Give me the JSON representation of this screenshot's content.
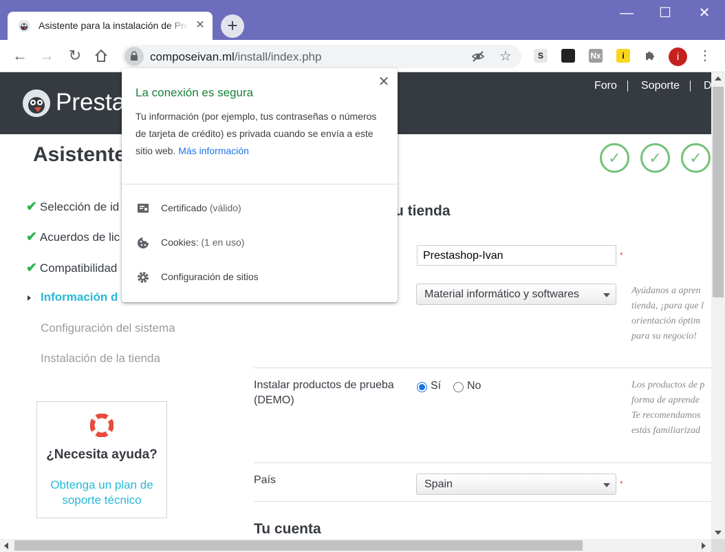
{
  "browser": {
    "tab_title": "Asistente para la instalación de PrestaShop",
    "tab_close": "✕",
    "new_tab": "+",
    "window_controls": {
      "minimize": "—",
      "maximize": "☐",
      "close": "✕"
    },
    "url_host": "composeivan.ml",
    "url_path": "/install/index.php",
    "extensions": [
      {
        "name": "S",
        "bg": "#e8e8e8",
        "color": "#222"
      },
      {
        "name": "",
        "bg": "#222",
        "color": "#fff"
      },
      {
        "name": "Nx",
        "bg": "#9e9e9e",
        "color": "#fff"
      },
      {
        "name": "i",
        "bg": "#f9d71c",
        "color": "#000"
      }
    ],
    "avatar_letter": "i"
  },
  "header": {
    "brand": "Presta",
    "nav": [
      "Foro",
      "Soporte",
      "D"
    ]
  },
  "wizard": {
    "title": "Asistente",
    "steps": [
      {
        "label": "Selección de id",
        "state": "done"
      },
      {
        "label": "Acuerdos de lic",
        "state": "done"
      },
      {
        "label": "Compatibilidad",
        "state": "done"
      },
      {
        "label": "Información d",
        "state": "active"
      },
      {
        "label": "Configuración del sistema",
        "state": "pending"
      },
      {
        "label": "Instalación de la tienda",
        "state": "pending"
      }
    ],
    "check_mark": "✓"
  },
  "help": {
    "title": "¿Necesita ayuda?",
    "link": "Obtenga un plan de soporte técnico"
  },
  "form": {
    "section_heading_fragment": "u tienda",
    "shop_name": "Prestashop-Ivan",
    "activity": "Material informático y softwares",
    "activity_hint": [
      "Ayúdanos a apren",
      "tienda, ¡para que l",
      "orientación óptim",
      "para su negocio!"
    ],
    "demo_label": "Instalar productos de prueba (DEMO)",
    "demo_yes": "Sí",
    "demo_no": "No",
    "demo_selected": "Sí",
    "demo_hint": [
      "Los productos de p",
      "forma de aprende",
      "Te recomendamos",
      "estás familiarizad"
    ],
    "country_label": "País",
    "country": "Spain",
    "required_mark": "*",
    "account_heading": "Tu cuenta"
  },
  "popup": {
    "title": "La conexión es segura",
    "close": "✕",
    "description": "Tu información (por ejemplo, tus contraseñas o números de tarjeta de crédito) es privada cuando se envía a este sitio web.",
    "more_info": "Más información",
    "rows": [
      {
        "label": "Certificado",
        "sub": "(válido)",
        "icon": "certificate-icon"
      },
      {
        "label": "Cookies:",
        "sub": "(1 en uso)",
        "icon": "cookie-icon"
      },
      {
        "label": "Configuración de sitios",
        "sub": "",
        "icon": "settings-icon"
      }
    ]
  },
  "colors": {
    "titlebar": "#6d6dbd",
    "ps_header": "#363a41",
    "accent": "#25b9d7",
    "success": "#72c279",
    "secure_green": "#188038",
    "link_blue": "#1a73e8"
  }
}
